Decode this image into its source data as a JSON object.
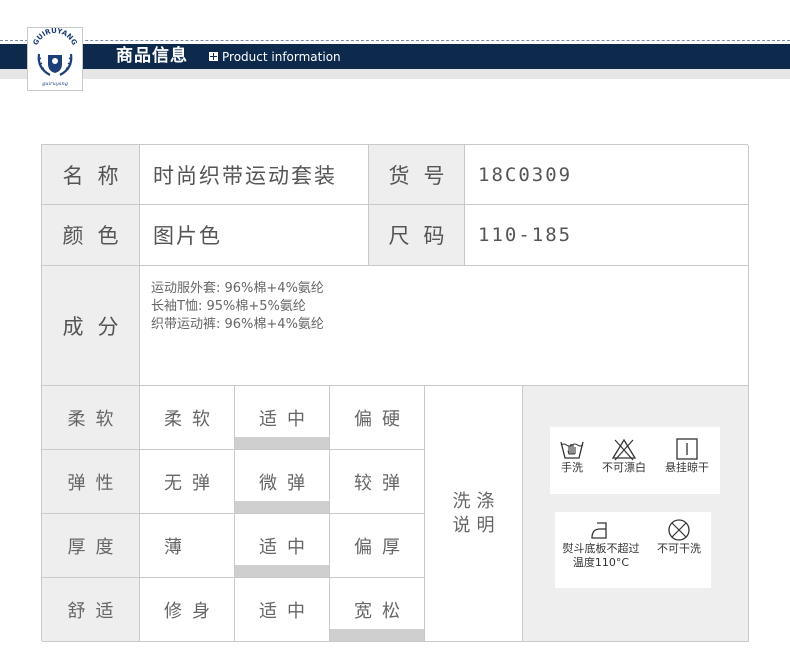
{
  "header": {
    "logo_text": "GUIRUYANG",
    "logo_subtext": "guiruyang",
    "title_cn": "商品信息",
    "title_en": "Product information"
  },
  "product": {
    "name_label": "名称",
    "name_value": "时尚织带运动套装",
    "item_no_label": "货号",
    "item_no_value": "18C0309",
    "color_label": "颜色",
    "color_value": "图片色",
    "size_label": "尺码",
    "size_value": "110-185",
    "composition_label": "成分",
    "composition": [
      "运动服外套: 96%棉+4%氨纶",
      "长袖T恤: 95%棉+5%氨纶",
      "织带运动裤: 96%棉+4%氨纶"
    ]
  },
  "attributes": [
    {
      "label": "柔软",
      "options": [
        "柔软",
        "适中",
        "偏硬"
      ],
      "selected": 1
    },
    {
      "label": "弹性",
      "options": [
        "无弹",
        "微弹",
        "较弹"
      ],
      "selected": 1
    },
    {
      "label": "厚度",
      "options": [
        "薄",
        "适中",
        "偏厚"
      ],
      "selected": 1
    },
    {
      "label": "舒适",
      "options": [
        "修身",
        "适中",
        "宽松"
      ],
      "selected": 2
    }
  ],
  "washing": {
    "label_line1": "洗涤",
    "label_line2": "说明",
    "care": [
      {
        "icon": "hand-wash-icon",
        "label": "手洗"
      },
      {
        "icon": "no-bleach-icon",
        "label": "不可漂白"
      },
      {
        "icon": "hang-dry-icon",
        "label": "悬挂晾干"
      },
      {
        "icon": "iron-icon",
        "label_line1": "熨斗底板不超过",
        "label_line2": "温度110°C"
      },
      {
        "icon": "no-dry-clean-icon",
        "label": "不可干洗"
      }
    ]
  },
  "colors": {
    "header_band": "#0d2a4d",
    "label_bg": "#eeeeee",
    "border": "#c9c9c9",
    "selected_bar": "#cfcfcf"
  }
}
